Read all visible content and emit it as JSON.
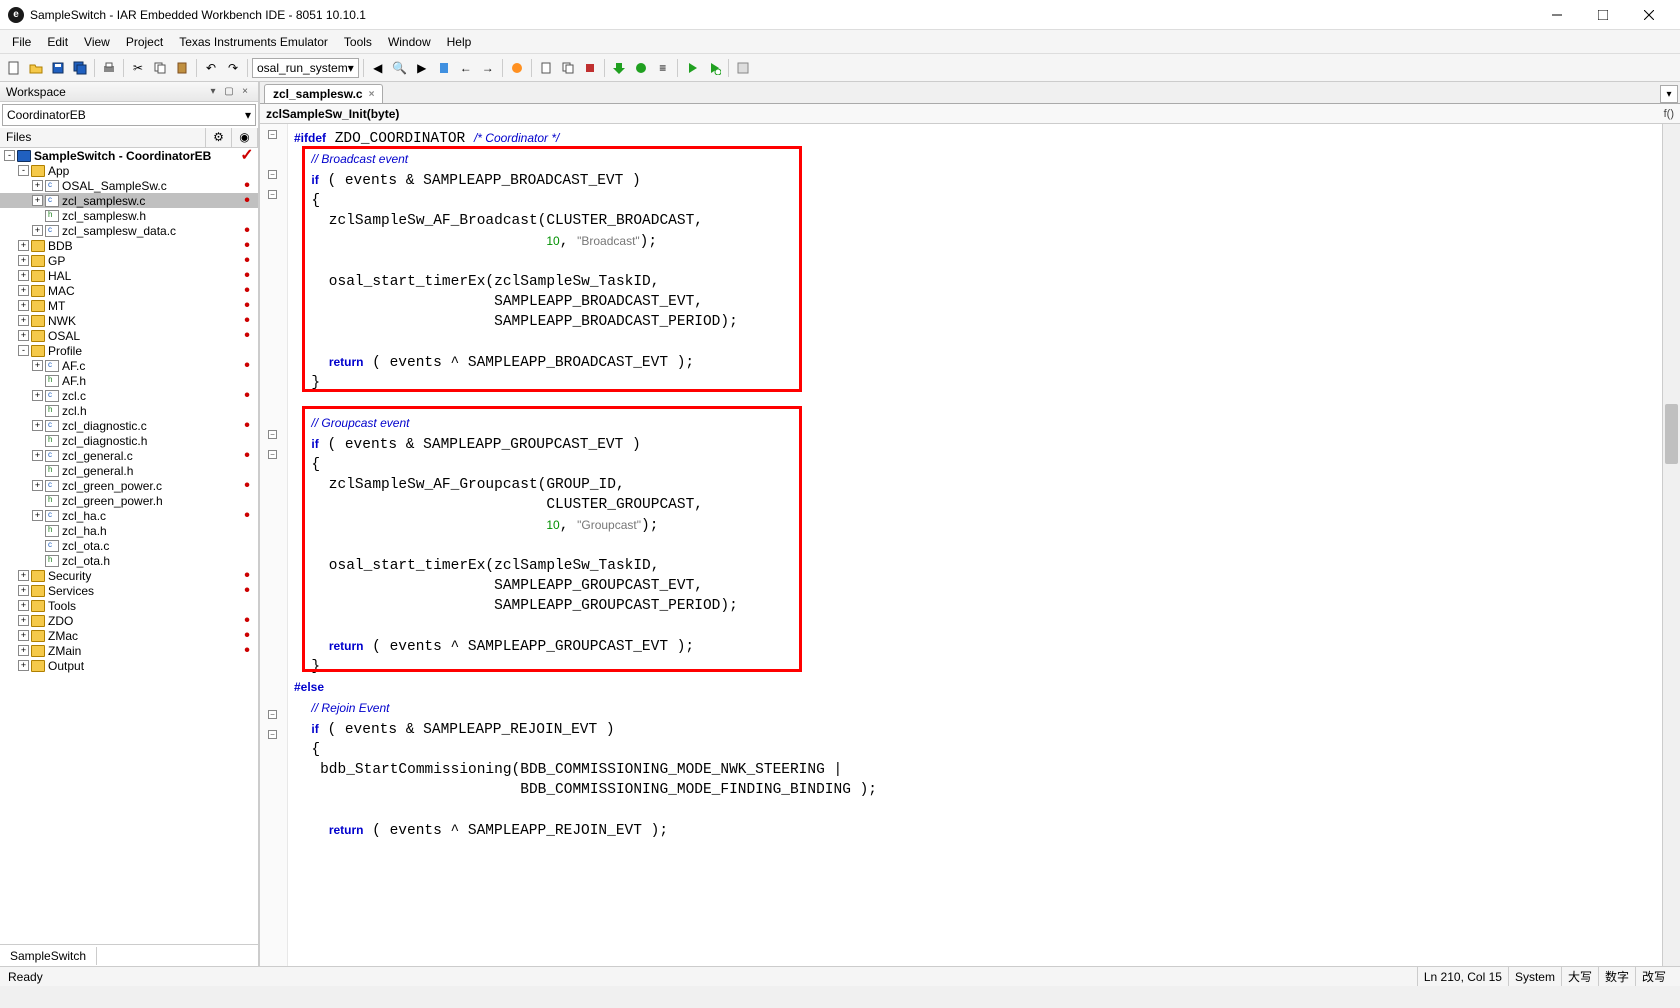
{
  "window": {
    "title": "SampleSwitch - IAR Embedded Workbench IDE - 8051 10.10.1"
  },
  "menu": [
    "File",
    "Edit",
    "View",
    "Project",
    "Texas Instruments Emulator",
    "Tools",
    "Window",
    "Help"
  ],
  "toolbar_combo": "osal_run_system",
  "workspace": {
    "title": "Workspace",
    "config": "CoordinatorEB",
    "cols": {
      "files": "Files"
    },
    "tree": [
      {
        "d": 0,
        "exp": "-",
        "icon": "proj",
        "label": "SampleSwitch - CoordinatorEB",
        "bold": true,
        "mark": "✓"
      },
      {
        "d": 1,
        "exp": "-",
        "icon": "folder",
        "label": "App"
      },
      {
        "d": 2,
        "exp": "+",
        "icon": "file-c",
        "label": "OSAL_SampleSw.c",
        "mark": "•"
      },
      {
        "d": 2,
        "exp": "+",
        "icon": "file-c",
        "label": "zcl_samplesw.c",
        "selected": true,
        "mark": "•"
      },
      {
        "d": 2,
        "exp": "",
        "icon": "file-h",
        "label": "zcl_samplesw.h"
      },
      {
        "d": 2,
        "exp": "+",
        "icon": "file-c",
        "label": "zcl_samplesw_data.c",
        "mark": "•"
      },
      {
        "d": 1,
        "exp": "+",
        "icon": "folder",
        "label": "BDB",
        "mark": "•"
      },
      {
        "d": 1,
        "exp": "+",
        "icon": "folder",
        "label": "GP",
        "mark": "•"
      },
      {
        "d": 1,
        "exp": "+",
        "icon": "folder",
        "label": "HAL",
        "mark": "•"
      },
      {
        "d": 1,
        "exp": "+",
        "icon": "folder",
        "label": "MAC",
        "mark": "•"
      },
      {
        "d": 1,
        "exp": "+",
        "icon": "folder",
        "label": "MT",
        "mark": "•"
      },
      {
        "d": 1,
        "exp": "+",
        "icon": "folder",
        "label": "NWK",
        "mark": "•"
      },
      {
        "d": 1,
        "exp": "+",
        "icon": "folder",
        "label": "OSAL",
        "mark": "•"
      },
      {
        "d": 1,
        "exp": "-",
        "icon": "folder",
        "label": "Profile"
      },
      {
        "d": 2,
        "exp": "+",
        "icon": "file-c",
        "label": "AF.c",
        "mark": "•"
      },
      {
        "d": 2,
        "exp": "",
        "icon": "file-h",
        "label": "AF.h"
      },
      {
        "d": 2,
        "exp": "+",
        "icon": "file-c",
        "label": "zcl.c",
        "mark": "•"
      },
      {
        "d": 2,
        "exp": "",
        "icon": "file-h",
        "label": "zcl.h"
      },
      {
        "d": 2,
        "exp": "+",
        "icon": "file-c",
        "label": "zcl_diagnostic.c",
        "mark": "•"
      },
      {
        "d": 2,
        "exp": "",
        "icon": "file-h",
        "label": "zcl_diagnostic.h"
      },
      {
        "d": 2,
        "exp": "+",
        "icon": "file-c",
        "label": "zcl_general.c",
        "mark": "•"
      },
      {
        "d": 2,
        "exp": "",
        "icon": "file-h",
        "label": "zcl_general.h"
      },
      {
        "d": 2,
        "exp": "+",
        "icon": "file-c",
        "label": "zcl_green_power.c",
        "mark": "•"
      },
      {
        "d": 2,
        "exp": "",
        "icon": "file-h",
        "label": "zcl_green_power.h"
      },
      {
        "d": 2,
        "exp": "+",
        "icon": "file-c",
        "label": "zcl_ha.c",
        "mark": "•"
      },
      {
        "d": 2,
        "exp": "",
        "icon": "file-h",
        "label": "zcl_ha.h"
      },
      {
        "d": 2,
        "exp": "",
        "icon": "file-c",
        "label": "zcl_ota.c"
      },
      {
        "d": 2,
        "exp": "",
        "icon": "file-h",
        "label": "zcl_ota.h"
      },
      {
        "d": 1,
        "exp": "+",
        "icon": "folder",
        "label": "Security",
        "mark": "•"
      },
      {
        "d": 1,
        "exp": "+",
        "icon": "folder",
        "label": "Services",
        "mark": "•"
      },
      {
        "d": 1,
        "exp": "+",
        "icon": "folder",
        "label": "Tools"
      },
      {
        "d": 1,
        "exp": "+",
        "icon": "folder",
        "label": "ZDO",
        "mark": "•"
      },
      {
        "d": 1,
        "exp": "+",
        "icon": "folder",
        "label": "ZMac",
        "mark": "•"
      },
      {
        "d": 1,
        "exp": "+",
        "icon": "folder",
        "label": "ZMain",
        "mark": "•"
      },
      {
        "d": 1,
        "exp": "+",
        "icon": "folder",
        "label": "Output"
      }
    ],
    "tab": "SampleSwitch"
  },
  "editor": {
    "tab": "zcl_samplesw.c",
    "context": "zclSampleSw_Init(byte)",
    "code_html": "<span class='pp'>#ifdef</span> ZDO_COORDINATOR <span class='cm'>/* Coordinator */</span>\n  <span class='cm'>// Broadcast event</span>\n  <span class='kw'>if</span> ( events & SAMPLEAPP_BROADCAST_EVT )\n  {\n    zclSampleSw_AF_Broadcast(CLUSTER_BROADCAST,\n                             <span class='num'>10</span>, <span class='str'>\"Broadcast\"</span>);\n    \n    osal_start_timerEx(zclSampleSw_TaskID,\n                       SAMPLEAPP_BROADCAST_EVT,\n                       SAMPLEAPP_BROADCAST_PERIOD);\n    \n    <span class='kw'>return</span> ( events ^ SAMPLEAPP_BROADCAST_EVT );\n  }\n  \n  <span class='cm'>// Groupcast event</span>\n  <span class='kw'>if</span> ( events & SAMPLEAPP_GROUPCAST_EVT )\n  {\n    zclSampleSw_AF_Groupcast(GROUP_ID,\n                             CLUSTER_GROUPCAST,\n                             <span class='num'>10</span>, <span class='str'>\"Groupcast\"</span>);\n    \n    osal_start_timerEx(zclSampleSw_TaskID,\n                       SAMPLEAPP_GROUPCAST_EVT,\n                       SAMPLEAPP_GROUPCAST_PERIOD);\n    \n    <span class='kw'>return</span> ( events ^ SAMPLEAPP_GROUPCAST_EVT );\n  }\n<span class='pp'>#else</span>\n  <span class='cm'>// Rejoin Event</span>\n  <span class='kw'>if</span> ( events & SAMPLEAPP_REJOIN_EVT )\n  {\n   bdb_StartCommissioning(BDB_COMMISSIONING_MODE_NWK_STEERING |\n                          BDB_COMMISSIONING_MODE_FINDING_BINDING );\n    \n    <span class='kw'>return</span> ( events ^ SAMPLEAPP_REJOIN_EVT );"
  },
  "status": {
    "ready": "Ready",
    "pos": "Ln 210, Col 15",
    "system": "System",
    "caps": "大写",
    "num": "数字",
    "ovr": "改写"
  }
}
